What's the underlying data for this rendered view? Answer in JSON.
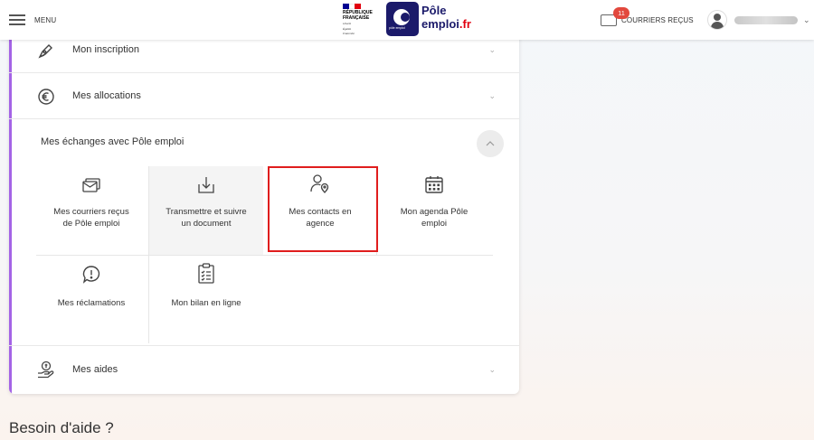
{
  "header": {
    "menu_label": "MENU",
    "republique": [
      "RÉPUBLIQUE",
      "FRANÇAISE"
    ],
    "motto": [
      "Liberté",
      "Égalité",
      "Fraternité"
    ],
    "pe_small": "pôle emploi",
    "pe_word_1": "Pôle",
    "pe_word_2a": "emploi",
    "pe_word_2b": ".fr",
    "courriers_count": "11",
    "courriers_label": "COURRIERS REÇUS",
    "flag_colors": [
      "#000091",
      "#ffffff",
      "#e1000f"
    ],
    "brand_color": "#1b1a6a"
  },
  "card": {
    "accent_color": "#a463e6",
    "items": [
      {
        "label": "Mon inscription",
        "icon": "pen-icon"
      },
      {
        "label": "Mes allocations",
        "icon": "euro-icon"
      }
    ],
    "section": {
      "title": "Mes échanges avec Pôle emploi",
      "tiles": [
        {
          "line1": "Mes courriers reçus",
          "line2": "de Pôle emploi",
          "icon": "mail-stack-icon"
        },
        {
          "line1": "Transmettre et suivre",
          "line2": "un document",
          "icon": "download-tray-icon"
        },
        {
          "line1": "Mes contacts en",
          "line2": "agence",
          "icon": "contact-location-icon"
        },
        {
          "line1": "Mon agenda Pôle",
          "line2": "emploi",
          "icon": "calendar-icon"
        },
        {
          "line1": "Mes réclamations",
          "line2": "",
          "icon": "speech-exclamation-icon"
        },
        {
          "line1": "Mon bilan en ligne",
          "line2": "",
          "icon": "clipboard-list-icon"
        }
      ]
    },
    "aides_label": "Mes aides",
    "aides_icon": "hand-coin-icon"
  },
  "help_title": "Besoin d'aide ?",
  "highlight_color": "#e01d1d"
}
